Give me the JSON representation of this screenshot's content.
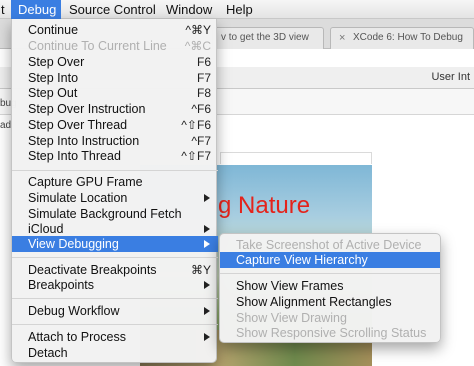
{
  "menubar": {
    "items": [
      "t",
      "Debug",
      "Source Control",
      "Window",
      "Help"
    ],
    "active": "Debug"
  },
  "background": {
    "tabs": [
      "v to get the 3D view",
      "XCode 6: How To Debug"
    ],
    "right_label": "User Int",
    "edge_label": "bug",
    "edge_label_2": "ad",
    "title_fragment": "g Nature"
  },
  "debug_menu": {
    "items": [
      {
        "label": "Continue",
        "shortcut": "^⌘Y",
        "disabled": false
      },
      {
        "label": "Continue To Current Line",
        "shortcut": "^⌘C",
        "disabled": true
      },
      {
        "label": "Step Over",
        "shortcut": "F6",
        "disabled": false
      },
      {
        "label": "Step Into",
        "shortcut": "F7",
        "disabled": false
      },
      {
        "label": "Step Out",
        "shortcut": "F8",
        "disabled": false
      },
      {
        "label": "Step Over Instruction",
        "shortcut": "^F6",
        "disabled": false
      },
      {
        "label": "Step Over Thread",
        "shortcut": "^⇧F6",
        "disabled": false
      },
      {
        "label": "Step Into Instruction",
        "shortcut": "^F7",
        "disabled": false
      },
      {
        "label": "Step Into Thread",
        "shortcut": "^⇧F7",
        "disabled": false
      },
      {
        "label": "Capture GPU Frame",
        "shortcut": "",
        "disabled": false
      },
      {
        "label": "Simulate Location",
        "shortcut": "",
        "disabled": false,
        "submenu": true
      },
      {
        "label": "Simulate Background Fetch",
        "shortcut": "",
        "disabled": false
      },
      {
        "label": "iCloud",
        "shortcut": "",
        "disabled": false,
        "submenu": true
      },
      {
        "label": "View Debugging",
        "shortcut": "",
        "disabled": false,
        "submenu": true,
        "highlighted": true
      },
      {
        "label": "Deactivate Breakpoints",
        "shortcut": "⌘Y",
        "disabled": false
      },
      {
        "label": "Breakpoints",
        "shortcut": "",
        "disabled": false,
        "submenu": true
      },
      {
        "label": "Debug Workflow",
        "shortcut": "",
        "disabled": false,
        "submenu": true
      },
      {
        "label": "Attach to Process",
        "shortcut": "",
        "disabled": false,
        "submenu": true
      },
      {
        "label": "Detach",
        "shortcut": "",
        "disabled": false
      }
    ]
  },
  "view_debugging_submenu": {
    "items": [
      {
        "label": "Take Screenshot of Active Device",
        "disabled": true
      },
      {
        "label": "Capture View Hierarchy",
        "disabled": false,
        "highlighted": true
      },
      {
        "label": "Show View Frames",
        "disabled": false
      },
      {
        "label": "Show Alignment Rectangles",
        "disabled": false
      },
      {
        "label": "Show View Drawing",
        "disabled": true
      },
      {
        "label": "Show Responsive Scrolling Status",
        "disabled": true
      }
    ]
  },
  "colors": {
    "highlight": "#3a7ee2",
    "disabled_text": "#b0b0b0",
    "title_red": "#e4231b"
  }
}
